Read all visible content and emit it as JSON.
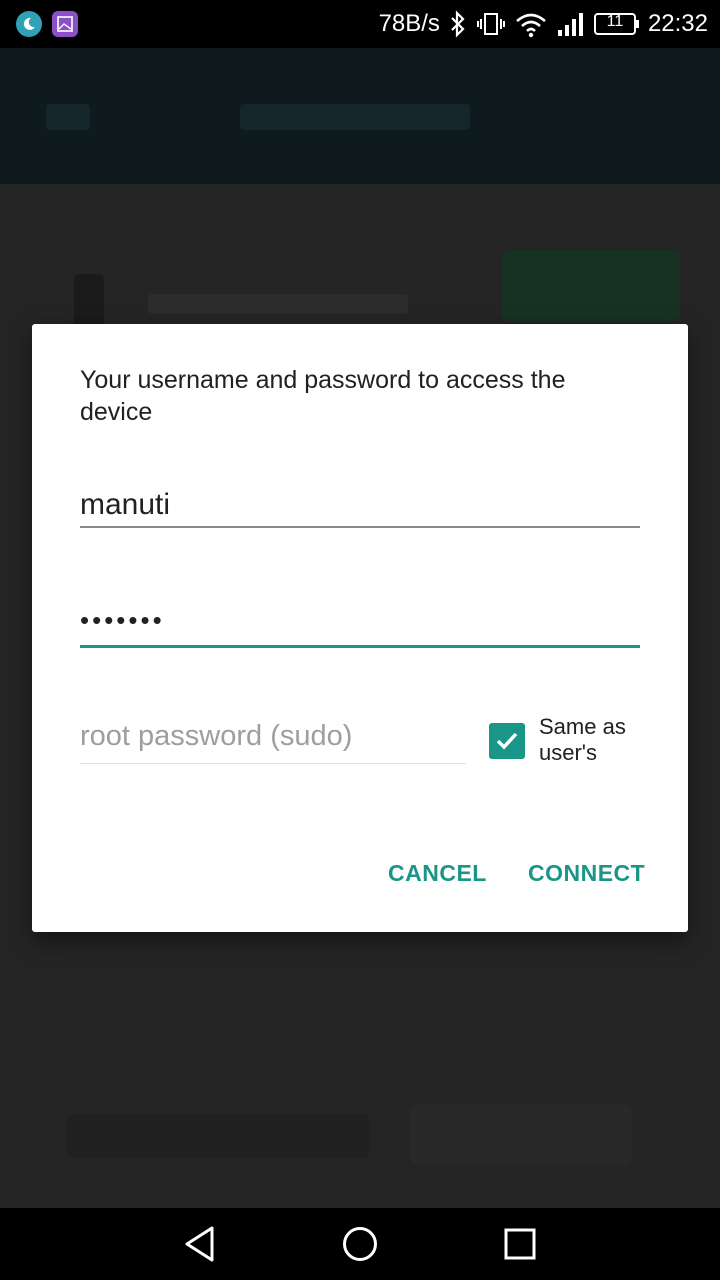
{
  "status_bar": {
    "net_speed": "78B/s",
    "battery": "11",
    "time": "22:32",
    "icons": [
      "moon-app-icon",
      "gallery-app-icon",
      "bluetooth-icon",
      "vibrate-icon",
      "wifi-icon",
      "signal-icon",
      "battery-icon"
    ]
  },
  "dialog": {
    "message": "Your username and password to access the device",
    "username_value": "manuti",
    "password_value": "•••••••",
    "root_password_placeholder": "root password (sudo)",
    "same_as_user_label": "Same as user's",
    "same_as_user_checked": true,
    "cancel_label": "CANCEL",
    "connect_label": "CONNECT"
  },
  "colors": {
    "accent": "#1a9688",
    "dialog_bg": "#ffffff",
    "scrim": "#232323"
  },
  "nav_bar": {
    "buttons": [
      "back-icon",
      "home-icon",
      "recents-icon"
    ]
  }
}
